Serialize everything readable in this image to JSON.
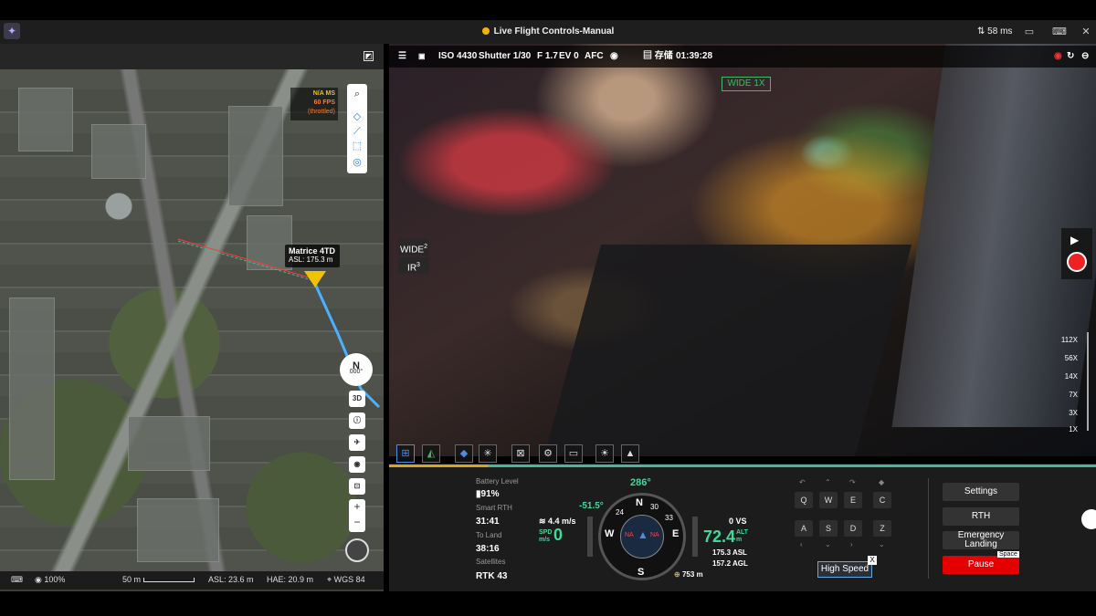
{
  "title": "Live Flight Controls-Manual",
  "status": {
    "ping": "58 ms"
  },
  "map": {
    "fps": {
      "line1": "N/A MS",
      "line2": "60 FPS",
      "line3": "(throttled)"
    },
    "drone": {
      "name": "Matrice 4TD",
      "asl": "ASL: 175.3 m"
    },
    "compass": "N",
    "compass_sub": "000°",
    "btn_3d": "3D",
    "statusbar": {
      "zoom": "100%",
      "scale": "50 m",
      "asl": "ASL: 23.6 m",
      "hae": "HAE: 20.9 m",
      "datum": "WGS 84"
    }
  },
  "camera": {
    "iso": "ISO 4430",
    "shutter": "Shutter 1/30",
    "fstop": "F 1.7",
    "ev": "EV 0",
    "af": "AFC",
    "storage": "存储",
    "time": "01:39:28",
    "view_label": "WIDE 1X",
    "lens_wide": "WIDE",
    "lens_wide_key": "2",
    "lens_ir": "IR",
    "lens_ir_key": "3",
    "zoom_levels": [
      "112X",
      "56X",
      "14X",
      "7X",
      "3X",
      "1X"
    ]
  },
  "telemetry": {
    "battery_label": "Battery Level",
    "battery": "91%",
    "smart_rth_label": "Smart RTH",
    "smart_rth": "31:41",
    "to_land_label": "To Land",
    "to_land": "38:16",
    "satellites_label": "Satellites",
    "satellites": "RTK 43",
    "heading": "286°",
    "pitch": "-51.5°",
    "wind": "4.4 m/s",
    "spd_label": "SPD\nm/s",
    "spd": "0",
    "vs": "0 VS",
    "alt": "72.4",
    "alt_unit": "ALT m",
    "asl": "175.3 ASL",
    "agl": "157.2 AGL",
    "dist": "753 m",
    "dial_n": "N",
    "dial_w": "W",
    "dial_e": "E",
    "dial_s": "S",
    "dial_30": "30",
    "dial_33": "33",
    "dial_24": "24",
    "dial_na_l": "NA",
    "dial_na_r": "NA"
  },
  "keys": {
    "q": "Q",
    "w": "W",
    "e": "E",
    "c": "C",
    "a": "A",
    "s": "S",
    "d": "D",
    "z": "Z",
    "high_speed": "High Speed",
    "x": "X"
  },
  "actions": {
    "settings": "Settings",
    "rth": "RTH",
    "emergency": "Emergency Landing",
    "pause": "Pause",
    "space": "Space"
  }
}
